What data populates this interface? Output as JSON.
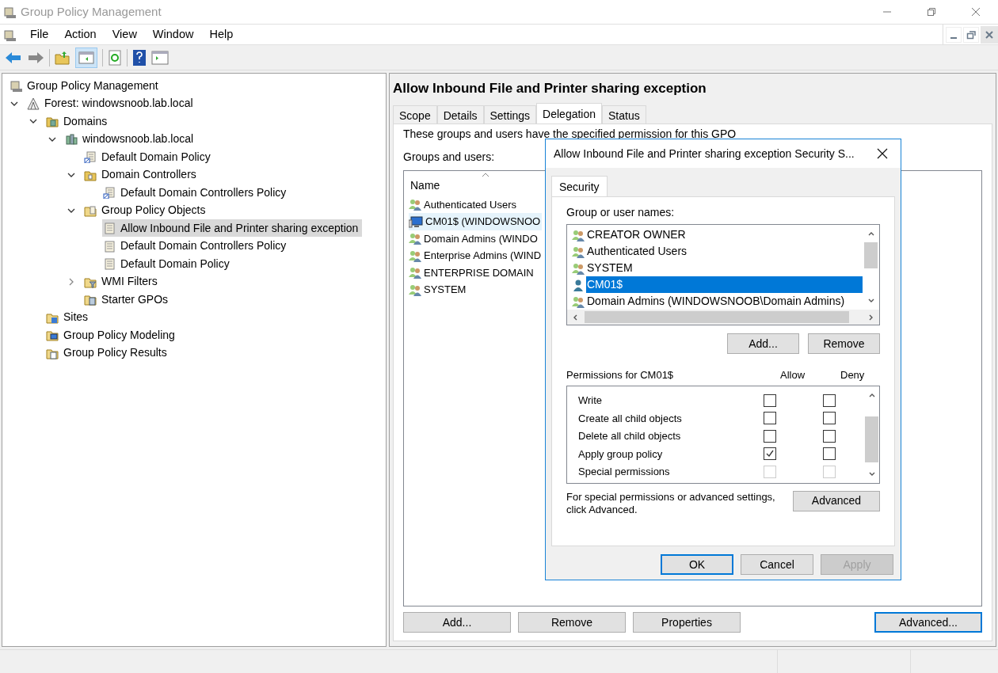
{
  "window": {
    "title": "Group Policy Management"
  },
  "menu": [
    "File",
    "Action",
    "View",
    "Window",
    "Help"
  ],
  "tree": {
    "label": "Group Policy Management",
    "kind": "gpm",
    "selected": false,
    "children": [
      {
        "label": "Forest: windowsnoob.lab.local",
        "kind": "forest",
        "selected": false,
        "expanded": true,
        "children": [
          {
            "label": "Domains",
            "kind": "domains",
            "selected": false,
            "expanded": true,
            "children": [
              {
                "label": "windowsnoob.lab.local",
                "kind": "domain",
                "selected": false,
                "expanded": true,
                "children": [
                  {
                    "label": "Default Domain Policy",
                    "kind": "gpo-link",
                    "selected": false
                  },
                  {
                    "label": "Domain Controllers",
                    "kind": "ou",
                    "selected": false,
                    "expanded": true,
                    "children": [
                      {
                        "label": "Default Domain Controllers Policy",
                        "kind": "gpo-link",
                        "selected": false
                      }
                    ]
                  },
                  {
                    "label": "Group Policy Objects",
                    "kind": "folder",
                    "selected": false,
                    "expanded": true,
                    "children": [
                      {
                        "label": "Allow Inbound File and Printer sharing exception",
                        "kind": "gpo",
                        "selected": true
                      },
                      {
                        "label": "Default Domain Controllers Policy",
                        "kind": "gpo",
                        "selected": false
                      },
                      {
                        "label": "Default Domain Policy",
                        "kind": "gpo",
                        "selected": false
                      }
                    ]
                  },
                  {
                    "label": "WMI Filters",
                    "kind": "filter",
                    "selected": false,
                    "expanded": false
                  },
                  {
                    "label": "Starter GPOs",
                    "kind": "starter",
                    "selected": false
                  }
                ]
              }
            ]
          },
          {
            "label": "Sites",
            "kind": "sites",
            "selected": false
          },
          {
            "label": "Group Policy Modeling",
            "kind": "modeling",
            "selected": false
          },
          {
            "label": "Group Policy Results",
            "kind": "results",
            "selected": false
          }
        ]
      }
    ]
  },
  "details": {
    "title": "Allow Inbound File and Printer sharing exception",
    "tabs": [
      {
        "label": "Scope",
        "selected": false
      },
      {
        "label": "Details",
        "selected": false
      },
      {
        "label": "Settings",
        "selected": false
      },
      {
        "label": "Delegation",
        "selected": true
      },
      {
        "label": "Status",
        "selected": false
      }
    ],
    "intro": "These groups and users have the specified permission for this GPO",
    "list_label": "Groups and users:",
    "column": "Name",
    "rows": [
      {
        "name": "Authenticated Users",
        "kind": "group",
        "selected": false
      },
      {
        "name": "CM01$ (WINDOWSNOO",
        "kind": "computer",
        "selected": true
      },
      {
        "name": "Domain Admins (WINDO",
        "kind": "group",
        "selected": false
      },
      {
        "name": "Enterprise Admins (WIND",
        "kind": "group",
        "selected": false
      },
      {
        "name": "ENTERPRISE DOMAIN",
        "kind": "group",
        "selected": false
      },
      {
        "name": "SYSTEM",
        "kind": "group",
        "selected": false
      }
    ],
    "buttons": [
      {
        "label": "Add...",
        "focused": false
      },
      {
        "label": "Remove",
        "focused": false
      },
      {
        "label": "Properties",
        "focused": false
      },
      {
        "label": "Advanced...",
        "focused": true
      }
    ]
  },
  "dialog": {
    "title": "Allow Inbound File and Printer sharing exception Security S...",
    "tab": "Security",
    "names_label": "Group or user names:",
    "names": [
      {
        "name": "CREATOR OWNER",
        "kind": "group",
        "selected": false
      },
      {
        "name": "Authenticated Users",
        "kind": "group",
        "selected": false
      },
      {
        "name": "SYSTEM",
        "kind": "group",
        "selected": false
      },
      {
        "name": "CM01$",
        "kind": "user",
        "selected": true
      },
      {
        "name": "Domain Admins (WINDOWSNOOB\\Domain Admins)",
        "kind": "group",
        "selected": false
      }
    ],
    "add": "Add...",
    "remove": "Remove",
    "perm_label": "Permissions for CM01$",
    "allow": "Allow",
    "deny": "Deny",
    "permissions": [
      {
        "name": "Write",
        "allow": false,
        "deny": false,
        "disabled": false
      },
      {
        "name": "Create all child objects",
        "allow": false,
        "deny": false,
        "disabled": false
      },
      {
        "name": "Delete all child objects",
        "allow": false,
        "deny": false,
        "disabled": false
      },
      {
        "name": "Apply group policy",
        "allow": true,
        "deny": false,
        "disabled": false
      },
      {
        "name": "Special permissions",
        "allow": false,
        "deny": false,
        "disabled": true
      }
    ],
    "advanced_note": "For special permissions or advanced settings, click Advanced.",
    "advanced": "Advanced",
    "buttons": [
      {
        "label": "OK",
        "focused": true,
        "disabled": false
      },
      {
        "label": "Cancel",
        "focused": false,
        "disabled": false
      },
      {
        "label": "Apply",
        "focused": false,
        "disabled": true
      }
    ]
  }
}
